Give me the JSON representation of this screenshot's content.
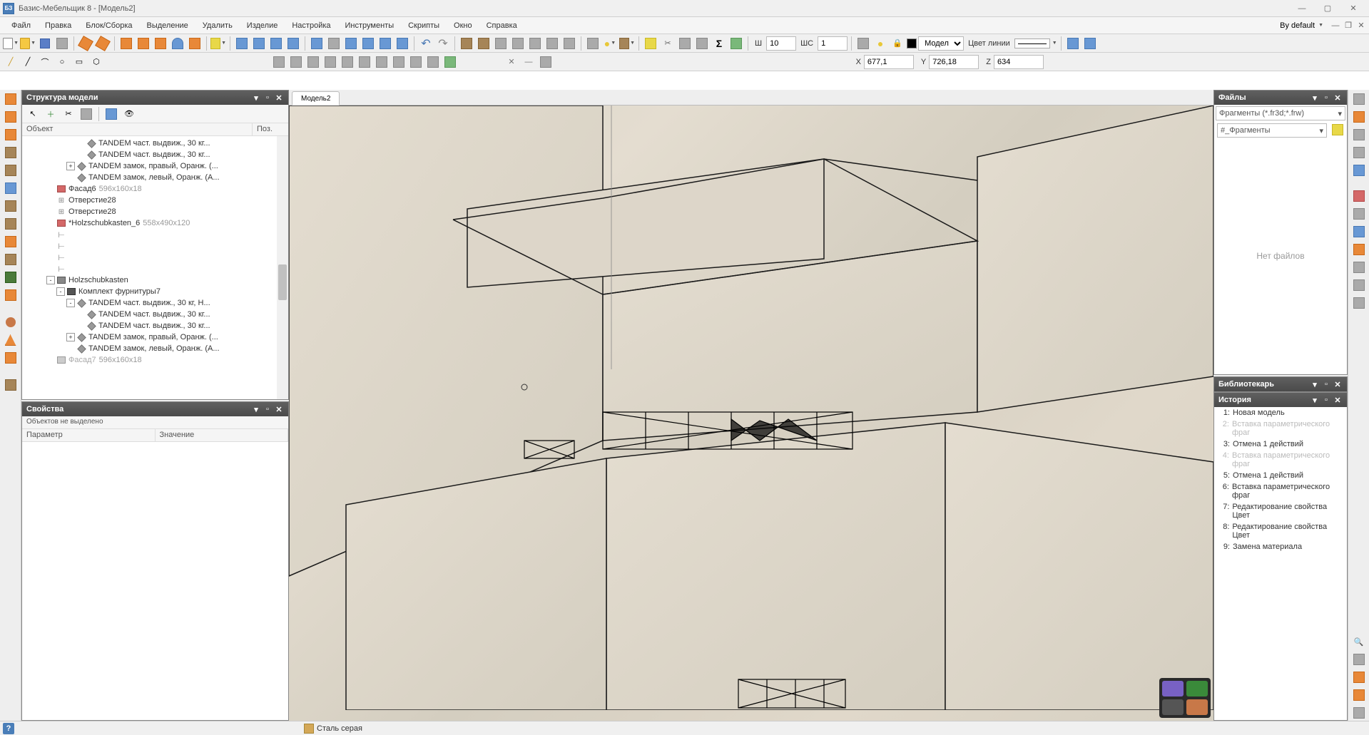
{
  "app": {
    "title": "Базис-Мебельщик 8 - [Модель2]",
    "icon_label": "БЗ"
  },
  "menu": {
    "items": [
      "Файл",
      "Правка",
      "Блок/Сборка",
      "Выделение",
      "Удалить",
      "Изделие",
      "Настройка",
      "Инструменты",
      "Скрипты",
      "Окно",
      "Справка"
    ],
    "default_label": "By default"
  },
  "toolbar1": {
    "ws_input": "10",
    "wc_input": "1",
    "ws_label": "Ш",
    "wc_label": "ШС",
    "mode_dropdown": "Модель",
    "line_color_label": "Цвет линии"
  },
  "coords": {
    "x_label": "X",
    "x_val": "677,1",
    "y_label": "Y",
    "y_val": "726,18",
    "z_label": "Z",
    "z_val": "634"
  },
  "viewport": {
    "tab": "Модель2"
  },
  "structure": {
    "title": "Структура модели",
    "col_object": "Объект",
    "col_pos": "Поз.",
    "tree": [
      {
        "indent": 6,
        "icon": "cube-gray",
        "label": "TANDEM част. выдвиж., 30 кг..."
      },
      {
        "indent": 6,
        "icon": "cube-gray",
        "label": "TANDEM част. выдвиж., 30 кг..."
      },
      {
        "indent": 4,
        "expand": "+",
        "icon": "cube-gray",
        "label": "TANDEM замок, правый, Оранж. (..."
      },
      {
        "indent": 5,
        "icon": "cube-gray",
        "label": "TANDEM замок, левый, Оранж. (А..."
      },
      {
        "indent": 3,
        "icon": "panel-red",
        "label": "Фасад6",
        "dim": "596x160x18"
      },
      {
        "indent": 3,
        "icon": "hole",
        "label": "Отверстие28"
      },
      {
        "indent": 3,
        "icon": "hole",
        "label": "Отверстие28"
      },
      {
        "indent": 3,
        "icon": "panel-red",
        "label": "*Holzschubkasten_6",
        "dim": "558x490x120"
      },
      {
        "indent": 3,
        "icon": "line",
        "label": ""
      },
      {
        "indent": 3,
        "icon": "line",
        "label": ""
      },
      {
        "indent": 3,
        "icon": "line",
        "label": ""
      },
      {
        "indent": 3,
        "icon": "line",
        "label": ""
      },
      {
        "indent": 2,
        "expand": "-",
        "icon": "assembly",
        "label": "Holzschubkasten"
      },
      {
        "indent": 3,
        "expand": "-",
        "icon": "assembly-dark",
        "label": "Комплект фурнитуры7"
      },
      {
        "indent": 4,
        "expand": "-",
        "icon": "cube-gray",
        "label": "TANDEM част. выдвиж., 30 кг, Н..."
      },
      {
        "indent": 6,
        "icon": "cube-gray",
        "label": "TANDEM част. выдвиж., 30 кг..."
      },
      {
        "indent": 6,
        "icon": "cube-gray",
        "label": "TANDEM част. выдвиж., 30 кг..."
      },
      {
        "indent": 4,
        "expand": "+",
        "icon": "cube-gray",
        "label": "TANDEM замок, правый, Оранж. (..."
      },
      {
        "indent": 5,
        "icon": "cube-gray",
        "label": "TANDEM замок, левый, Оранж. (А..."
      },
      {
        "indent": 3,
        "icon": "panel-gray",
        "label": "Фасад7",
        "dim": "596x160x18",
        "dimmed": true
      }
    ]
  },
  "properties": {
    "title": "Свойства",
    "status": "Объектов не выделено",
    "col_param": "Параметр",
    "col_value": "Значение"
  },
  "files": {
    "title": "Файлы",
    "filter": "Фрагменты (*.fr3d;*.frw)",
    "folder": "#_Фрагменты",
    "empty": "Нет файлов"
  },
  "librarian": {
    "title": "Библиотекарь"
  },
  "history": {
    "title": "История",
    "items": [
      {
        "n": "1:",
        "label": "Новая модель",
        "dim": false
      },
      {
        "n": "2:",
        "label": "Вставка параметрического фраг",
        "dim": true
      },
      {
        "n": "3:",
        "label": "Отмена 1 действий",
        "dim": false
      },
      {
        "n": "4:",
        "label": "Вставка параметрического фраг",
        "dim": true
      },
      {
        "n": "5:",
        "label": "Отмена 1 действий",
        "dim": false
      },
      {
        "n": "6:",
        "label": "Вставка параметрического фраг",
        "dim": false
      },
      {
        "n": "7:",
        "label": "Редактирование свойства Цвет",
        "dim": false
      },
      {
        "n": "8:",
        "label": "Редактирование свойства Цвет",
        "dim": false
      },
      {
        "n": "9:",
        "label": "Замена материала",
        "dim": false
      }
    ]
  },
  "statusbar": {
    "material": "Сталь серая"
  }
}
